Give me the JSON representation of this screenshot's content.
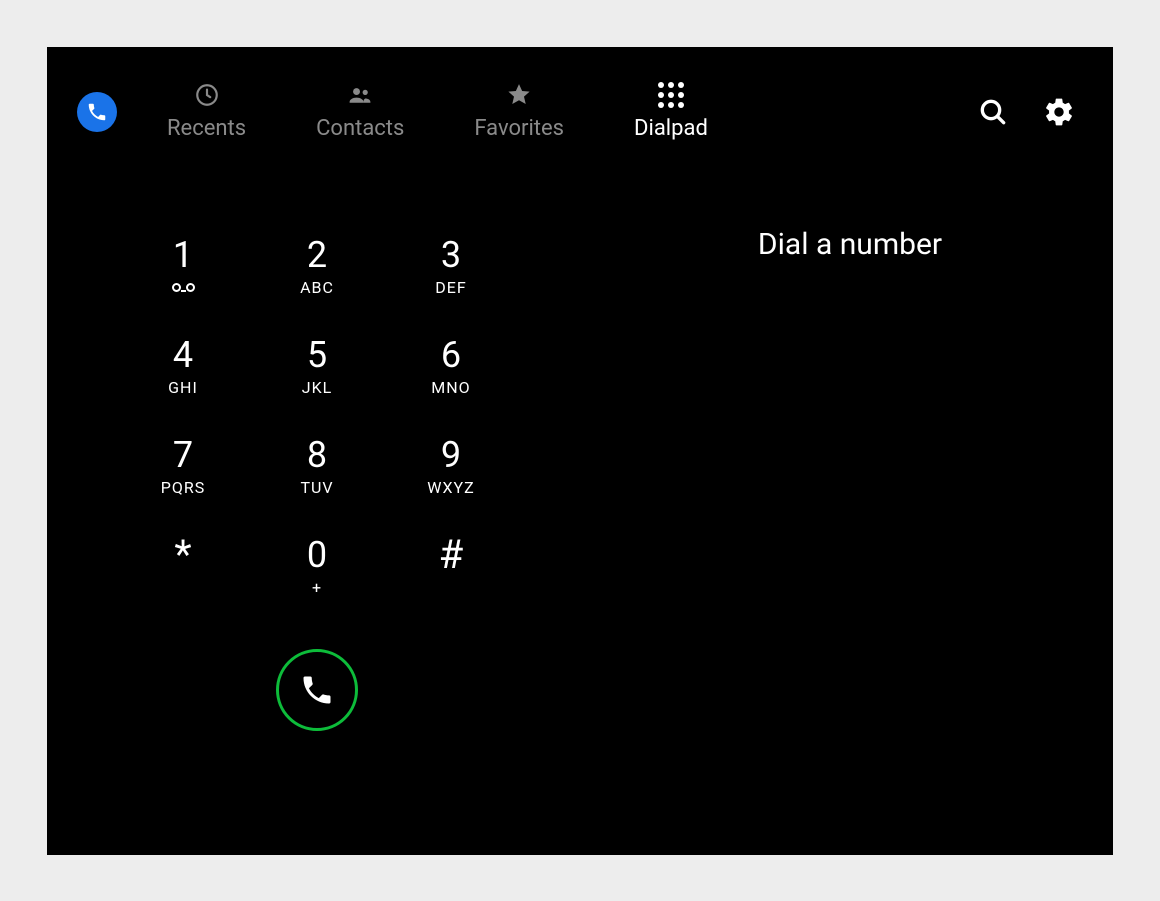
{
  "tabs": {
    "recents": "Recents",
    "contacts": "Contacts",
    "favorites": "Favorites",
    "dialpad": "Dialpad"
  },
  "display": {
    "prompt": "Dial a number"
  },
  "keys": {
    "k1": {
      "digit": "1",
      "letters": ""
    },
    "k2": {
      "digit": "2",
      "letters": "ABC"
    },
    "k3": {
      "digit": "3",
      "letters": "DEF"
    },
    "k4": {
      "digit": "4",
      "letters": "GHI"
    },
    "k5": {
      "digit": "5",
      "letters": "JKL"
    },
    "k6": {
      "digit": "6",
      "letters": "MNO"
    },
    "k7": {
      "digit": "7",
      "letters": "PQRS"
    },
    "k8": {
      "digit": "8",
      "letters": "TUV"
    },
    "k9": {
      "digit": "9",
      "letters": "WXYZ"
    },
    "kstar": {
      "digit": "*",
      "letters": ""
    },
    "k0": {
      "digit": "0",
      "letters": "+"
    },
    "khash": {
      "digit": "#",
      "letters": ""
    }
  }
}
